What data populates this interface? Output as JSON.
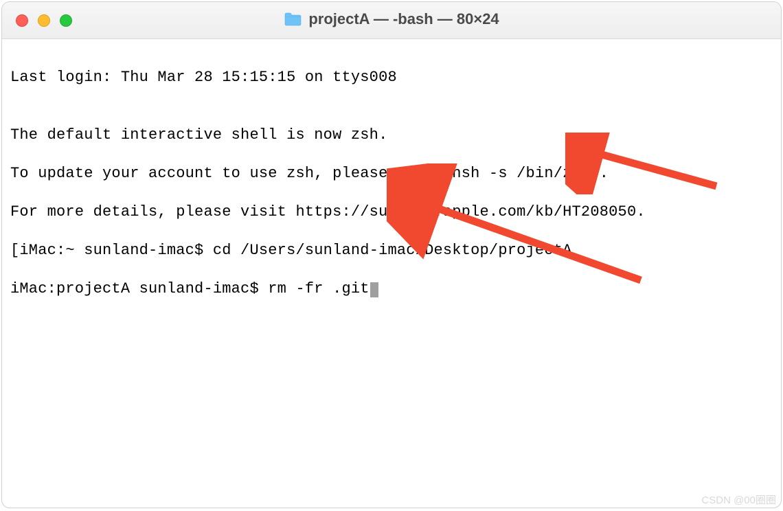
{
  "window": {
    "title": "projectA — -bash — 80×24",
    "folder_icon": "folder-icon"
  },
  "terminal": {
    "lines": {
      "l0": "Last login: Thu Mar 28 15:15:15 on ttys008",
      "l1": "",
      "l2": "The default interactive shell is now zsh.",
      "l3": "To update your account to use zsh, please run `chsh -s /bin/zsh`.",
      "l4": "For more details, please visit https://support.apple.com/kb/HT208050.",
      "l5_prefix": "[",
      "l5_body": "iMac:~ sunland-imac$ cd /Users/sunland-imac/Desktop/projectA",
      "l6": "iMac:projectA sunland-imac$ rm -fr .git"
    }
  },
  "traffic": {
    "close": "close",
    "minimize": "minimize",
    "maximize": "maximize"
  },
  "annotations": {
    "arrow1": "annotation-arrow",
    "arrow2": "annotation-arrow"
  },
  "watermark": "CSDN @00圈圈"
}
